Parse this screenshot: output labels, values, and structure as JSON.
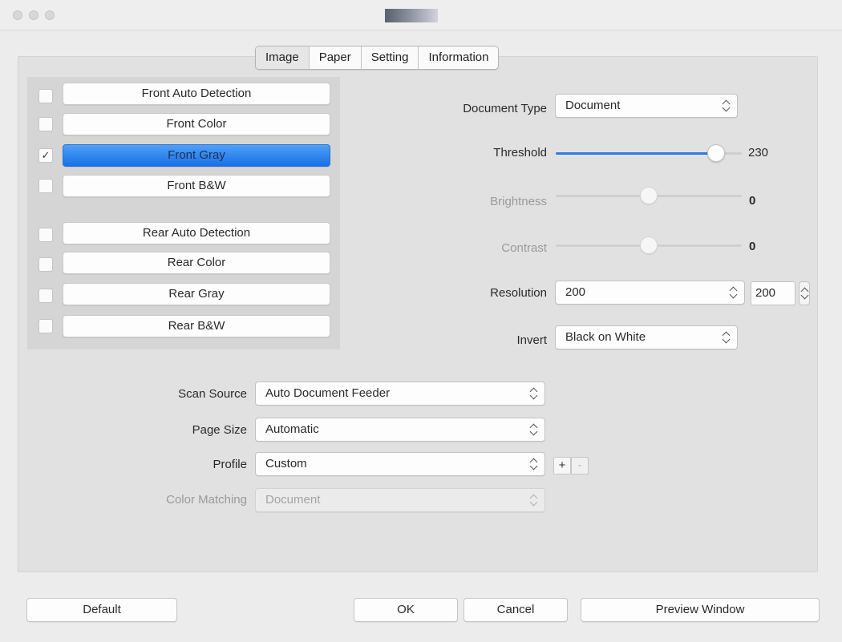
{
  "tabs": [
    {
      "label": "Image",
      "active": true
    },
    {
      "label": "Paper",
      "active": false
    },
    {
      "label": "Setting",
      "active": false
    },
    {
      "label": "Information",
      "active": false
    }
  ],
  "color_modes": [
    {
      "label": "Front Auto Detection",
      "checked": false,
      "selected": false
    },
    {
      "label": "Front Color",
      "checked": false,
      "selected": false
    },
    {
      "label": "Front Gray",
      "checked": true,
      "selected": true
    },
    {
      "label": "Front B&W",
      "checked": false,
      "selected": false
    },
    {
      "label": "Rear Auto Detection",
      "checked": false,
      "selected": false
    },
    {
      "label": "Rear Color",
      "checked": false,
      "selected": false
    },
    {
      "label": "Rear Gray",
      "checked": false,
      "selected": false
    },
    {
      "label": "Rear B&W",
      "checked": false,
      "selected": false
    }
  ],
  "check_mark": "✓",
  "document_type": {
    "label": "Document Type",
    "value": "Document"
  },
  "threshold": {
    "label": "Threshold",
    "value": "230",
    "level": 0.86,
    "enabled": true
  },
  "brightness": {
    "label": "Brightness",
    "value": "0",
    "level": 0.5,
    "enabled": false
  },
  "contrast": {
    "label": "Contrast",
    "value": "0",
    "level": 0.5,
    "enabled": false
  },
  "resolution": {
    "label": "Resolution",
    "value": "200",
    "custom_value": "200"
  },
  "invert": {
    "label": "Invert",
    "value": "Black on White"
  },
  "scan_source": {
    "label": "Scan Source",
    "value": "Auto Document Feeder"
  },
  "page_size": {
    "label": "Page Size",
    "value": "Automatic"
  },
  "profile": {
    "label": "Profile",
    "value": "Custom",
    "add_label": "+",
    "remove_label": "-"
  },
  "color_matching": {
    "label": "Color Matching",
    "value": "Document",
    "enabled": false
  },
  "buttons": {
    "default": "Default",
    "ok": "OK",
    "cancel": "Cancel",
    "preview": "Preview Window"
  },
  "colors": {
    "accent": "#2f7be8",
    "selected_row": "#1a6fe6",
    "panel": "#e1e1e1"
  }
}
